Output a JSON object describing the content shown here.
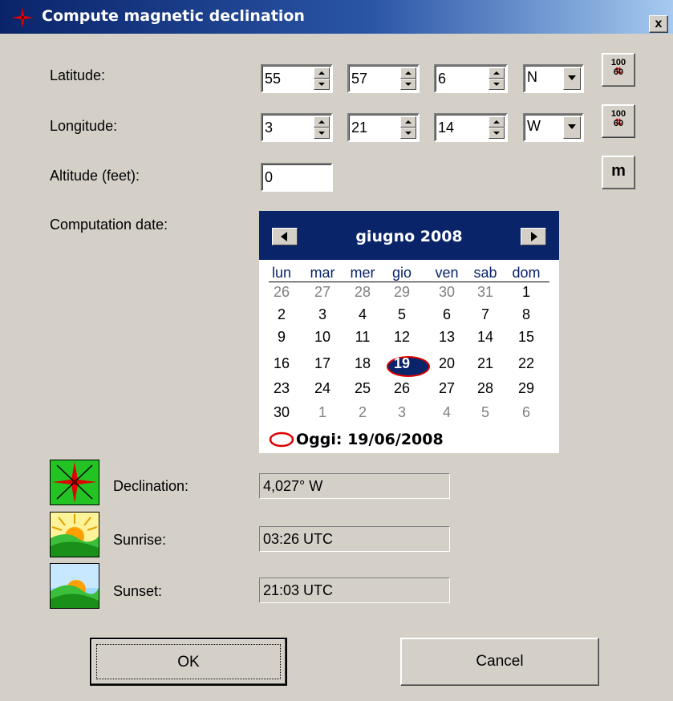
{
  "window": {
    "title": "Compute magnetic declination",
    "close_label": "x"
  },
  "labels": {
    "latitude": "Latitude:",
    "longitude": "Longitude:",
    "altitude": "Altitude (feet):",
    "computation_date": "Computation date:"
  },
  "latitude": {
    "degrees": "55",
    "minutes": "57",
    "seconds": "6",
    "hemisphere": "N"
  },
  "longitude": {
    "degrees": "3",
    "minutes": "21",
    "seconds": "14",
    "hemisphere": "W"
  },
  "altitude": {
    "value": "0"
  },
  "converter": {
    "top": "100",
    "bottom": "60"
  },
  "units_button": {
    "label": "m"
  },
  "calendar": {
    "month_title": "giugno 2008",
    "weekdays": [
      "lun",
      "mar",
      "mer",
      "gio",
      "ven",
      "sab",
      "dom"
    ],
    "weeks": [
      [
        "26",
        "27",
        "28",
        "29",
        "30",
        "31",
        "1"
      ],
      [
        "2",
        "3",
        "4",
        "5",
        "6",
        "7",
        "8"
      ],
      [
        "9",
        "10",
        "11",
        "12",
        "13",
        "14",
        "15"
      ],
      [
        "16",
        "17",
        "18",
        "19",
        "20",
        "21",
        "22"
      ],
      [
        "23",
        "24",
        "25",
        "26",
        "27",
        "28",
        "29"
      ],
      [
        "30",
        "1",
        "2",
        "3",
        "4",
        "5",
        "6"
      ]
    ],
    "selected_day": "19",
    "today_label": "Oggi: 19/06/2008"
  },
  "results": {
    "declination_label": "Declination:",
    "declination_value": "4,027° W",
    "sunrise_label": "Sunrise:",
    "sunrise_value": "03:26 UTC",
    "sunset_label": "Sunset:",
    "sunset_value": "21:03 UTC"
  },
  "buttons": {
    "ok": "OK",
    "cancel": "Cancel"
  },
  "colors": {
    "titlebar": "#0a246a",
    "calendar_header": "#0a246a",
    "today_mark": "#e00000",
    "face": "#d4d0c8"
  }
}
